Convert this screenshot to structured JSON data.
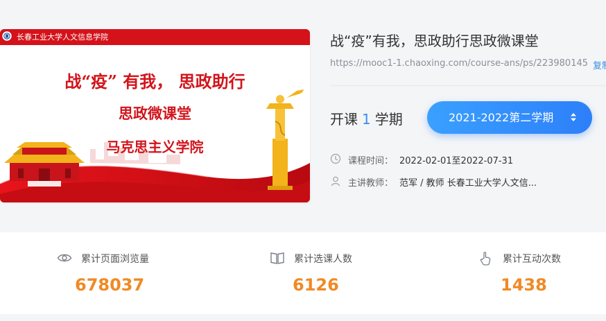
{
  "cover": {
    "university_strip": "长春工业大学人文信息学院",
    "line1": "战“疫” 有我， 思政助行",
    "line2": "思政微课堂",
    "line3": "马克思主义学院"
  },
  "course": {
    "title": "战“疫”有我，思政助行思政微课堂",
    "url": "https://mooc1-1.chaoxing.com/course-ans/ps/223980145",
    "copy_label": "复制"
  },
  "session": {
    "prefix": "开课",
    "count": "1",
    "suffix": "学期",
    "term_selected": "2021-2022第二学期"
  },
  "meta": {
    "time_label": "课程时间：",
    "time_value": "2022-02-01至2022-07-31",
    "teacher_label": "主讲教师：",
    "teacher_value": "范军 / 教师 长春工业大学人文信..."
  },
  "stats": [
    {
      "icon": "eye-icon",
      "label": "累计页面浏览量",
      "value": "678037"
    },
    {
      "icon": "book-icon",
      "label": "累计选课人数",
      "value": "6126"
    },
    {
      "icon": "tap-hand-icon",
      "label": "累计互动次数",
      "value": "1438"
    }
  ],
  "colors": {
    "accent_blue": "#3a8ee6",
    "stat_orange": "#f08a24",
    "cover_red": "#d2141b"
  }
}
